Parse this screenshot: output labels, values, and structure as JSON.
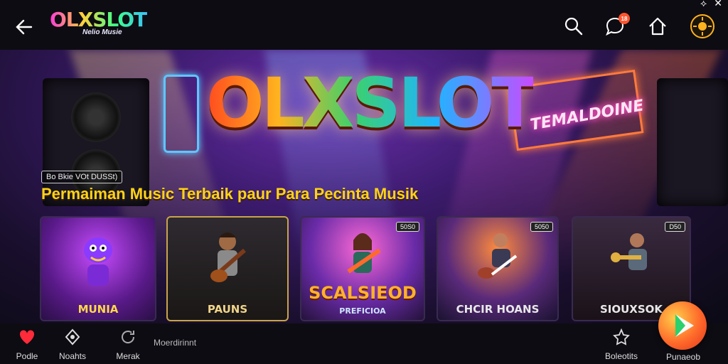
{
  "header": {
    "logo_text": "OLXSLOT",
    "logo_subtitle": "Nelio Musie",
    "badge_count": "18",
    "back_icon": "arrow-left-icon",
    "icons": [
      "search-icon",
      "chat-icon",
      "home-icon",
      "sun-icon"
    ]
  },
  "system": {
    "status_text": "⟡",
    "close_text": "✕"
  },
  "hero": {
    "title": "OLXSLOT",
    "neon_sign": "TEMALDOINE",
    "tag": "Bo Bkie VOt DUSSt)",
    "headline": "Permaiman Music Terbaik paur Para Pecinta Musik"
  },
  "cards": [
    {
      "label": "MUNIA",
      "tag": "",
      "accent": "#9b3bd5"
    },
    {
      "label": "PAUNS",
      "tag": "",
      "accent": "#c9a44a"
    },
    {
      "label": "SCALSIEOD",
      "sub": "PREFICIOA",
      "tag": "50S0",
      "accent": "#ff7a2b"
    },
    {
      "label": "CHCIR HOANS",
      "tag": "5050",
      "accent": "#2b7aff"
    },
    {
      "label": "SIOUXSOK",
      "tag": "D50",
      "accent": "#c4a24a"
    }
  ],
  "bottom_nav": [
    {
      "label": "Podle",
      "icon": "heart-icon"
    },
    {
      "label": "Noahts",
      "icon": "diamond-icon"
    },
    {
      "label": "Merak",
      "icon": "refresh-icon"
    },
    {
      "label": "Moerdirinnt",
      "icon": ""
    },
    {
      "label": "Boleotits",
      "icon": "star-icon"
    },
    {
      "label": "Punaeob",
      "icon": "play-icon"
    }
  ]
}
